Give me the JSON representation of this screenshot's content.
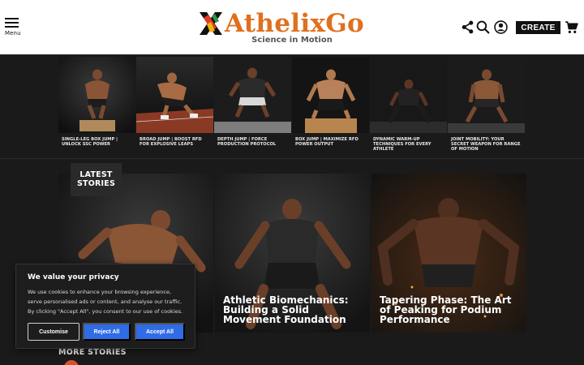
{
  "header": {
    "menu_label": "Menu",
    "logo_text": "AthelixGo",
    "tagline": "Science in Motion",
    "create_label": "CREATE",
    "icons": [
      "share-icon",
      "search-icon",
      "user-icon",
      "cart-icon"
    ]
  },
  "strip": {
    "items": [
      {
        "caption": "SINGLE-LEG BOX JUMP | UNLOCK SSC POWER"
      },
      {
        "caption": "BROAD JUMP | BOOST RFD FOR EXPLOSIVE LEAPS"
      },
      {
        "caption": "DEPTH JUMP | FORCE PRODUCTION PROTOCOL"
      },
      {
        "caption": "BOX JUMP | MAXIMIZE RFD POWER OUTPUT"
      },
      {
        "caption": "DYNAMIC WARM-UP TECHNIQUES FOR EVERY ATHLETE"
      },
      {
        "caption": "JOINT MOBILITY: YOUR SECRET WEAPON FOR RANGE OF MOTION"
      }
    ]
  },
  "latest": {
    "badge": "LATEST STORIES",
    "stories": [
      {
        "title": ""
      },
      {
        "title": "Athletic Biomechanics: Building a Solid Movement Foundation"
      },
      {
        "title": "Tapering Phase: The Art of Peaking for Podium Performance"
      }
    ]
  },
  "more_stories_label": "MORE STORIES",
  "cookie": {
    "title": "We value your privacy",
    "body": "We use cookies to enhance your browsing experience, serve personalised ads or content, and analyse our traffic. By clicking \"Accept All\", you consent to our use of cookies.",
    "customise_label": "Customise",
    "reject_label": "Reject All",
    "accept_label": "Accept All"
  },
  "colors": {
    "brand_orange": "#e0701e",
    "cookie_button_blue": "#2f6ce5",
    "page_background": "#1a1a1a"
  }
}
